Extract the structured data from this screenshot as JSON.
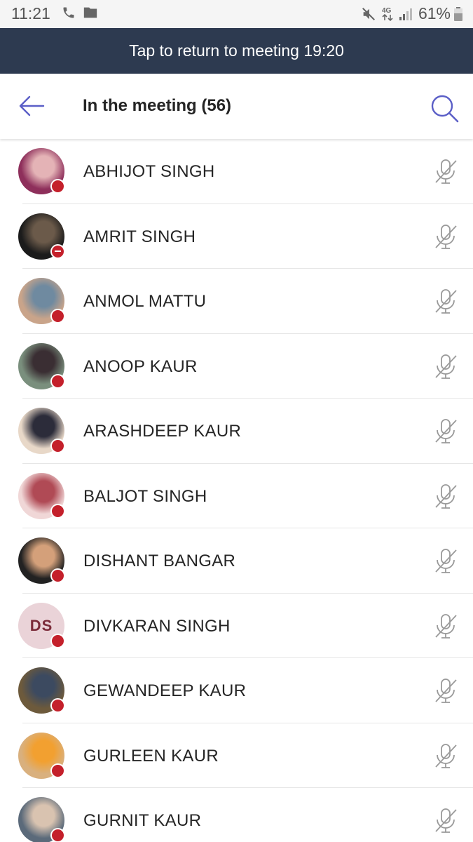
{
  "status_bar": {
    "time": "11:21",
    "network": "4G",
    "battery": "61%",
    "icons": [
      "phone-icon",
      "folder-icon",
      "mute-icon",
      "network-4g-icon",
      "signal-icon",
      "battery-icon"
    ]
  },
  "banner": {
    "text": "Tap to return to meeting 19:20"
  },
  "header": {
    "title": "In the meeting (56)",
    "icons": [
      "back-arrow-icon",
      "search-icon"
    ]
  },
  "accent_color": "#5b5fc7",
  "presence_color": "#c4202b",
  "participants": [
    {
      "name": "ABHIJOT SINGH",
      "presence": "busy",
      "avatar": "photo"
    },
    {
      "name": "AMRIT SINGH",
      "presence": "do-not-disturb",
      "avatar": "photo"
    },
    {
      "name": "ANMOL MATTU",
      "presence": "busy",
      "avatar": "photo"
    },
    {
      "name": "ANOOP KAUR",
      "presence": "busy",
      "avatar": "photo"
    },
    {
      "name": "ARASHDEEP KAUR",
      "presence": "busy",
      "avatar": "photo"
    },
    {
      "name": "BALJOT SINGH",
      "presence": "busy",
      "avatar": "photo"
    },
    {
      "name": "DISHANT BANGAR",
      "presence": "busy",
      "avatar": "photo"
    },
    {
      "name": "DIVKARAN SINGH",
      "presence": "busy",
      "avatar": "initials",
      "initials": "DS"
    },
    {
      "name": "GEWANDEEP KAUR",
      "presence": "busy",
      "avatar": "photo"
    },
    {
      "name": "GURLEEN KAUR",
      "presence": "busy",
      "avatar": "photo"
    },
    {
      "name": "GURNIT KAUR",
      "presence": "busy",
      "avatar": "photo"
    }
  ]
}
